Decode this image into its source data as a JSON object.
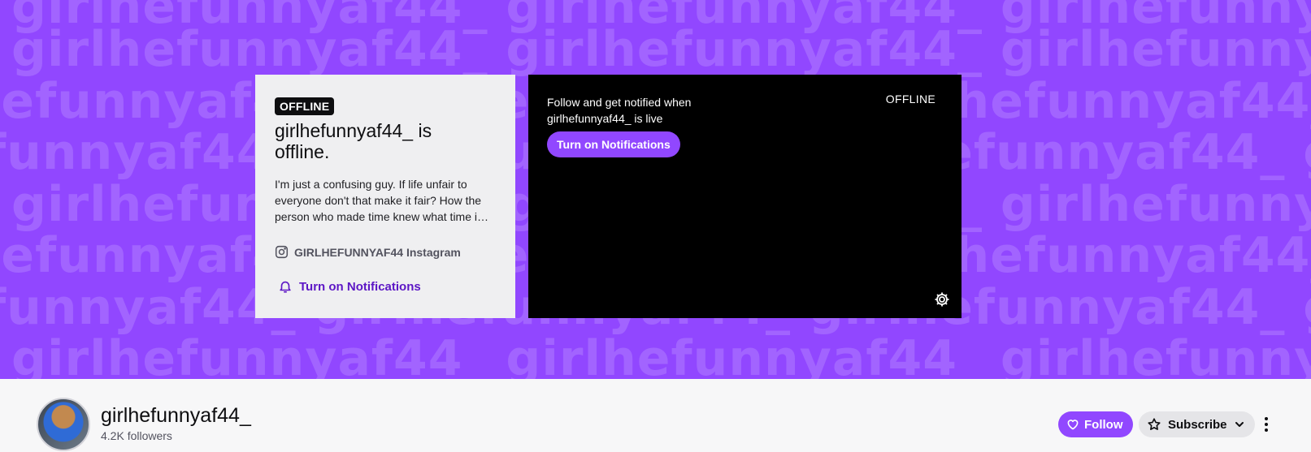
{
  "banner": {
    "watermark_text": "girlhefunnyaf44_ girlhefunnyaf44_ girlhefunnyaf44_ girlhefunnyaf44_ girlhefunnyaf44_",
    "background_color": "#9147ff"
  },
  "info_card": {
    "badge": "OFFLINE",
    "title": "girlhefunnyaf44_ is offline.",
    "description": "I'm just a confusing guy. If life unfair to everyone don't that make it fair? How the person who made time knew what time i…",
    "social_link": "GIRLHEFUNNYAF44 Instagram",
    "notifications_label": "Turn on Notifications"
  },
  "player": {
    "message": "Follow and get notified when girlhefunnyaf44_ is live",
    "notifications_button": "Turn on Notifications",
    "status": "OFFLINE"
  },
  "channel": {
    "name": "girlhefunnyaf44_",
    "followers": "4.2K followers",
    "follow_label": "Follow",
    "subscribe_label": "Subscribe"
  },
  "colors": {
    "accent": "#9147ff",
    "link": "#5c16c5"
  },
  "icons": {
    "social": "instagram-icon",
    "notifications": "bell-icon",
    "settings": "gear-icon",
    "follow": "heart-icon",
    "subscribe": "star-icon",
    "dropdown": "chevron-down-icon",
    "more": "more-vertical-icon"
  }
}
